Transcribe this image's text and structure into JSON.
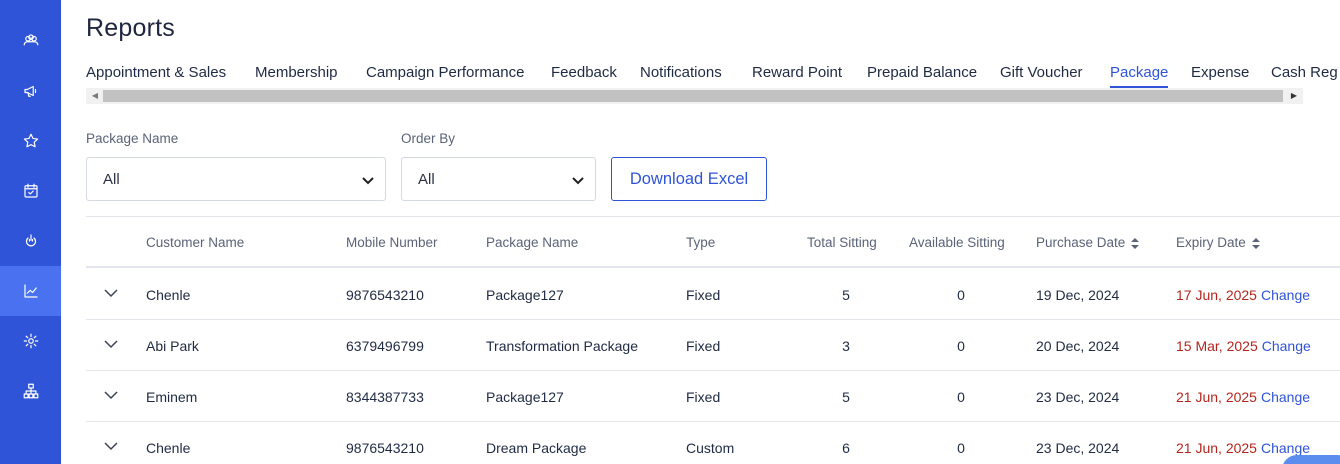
{
  "sidebar": {
    "items": [
      {
        "icon": "group-icon",
        "active": false
      },
      {
        "icon": "megaphone-icon",
        "active": false
      },
      {
        "icon": "star-icon",
        "active": false
      },
      {
        "icon": "calendar-icon",
        "active": false
      },
      {
        "icon": "touch-icon",
        "active": false
      },
      {
        "icon": "chart-icon",
        "active": true
      },
      {
        "icon": "gear-icon",
        "active": false
      },
      {
        "icon": "hierarchy-icon",
        "active": false
      }
    ]
  },
  "page": {
    "title": "Reports"
  },
  "tabs": [
    {
      "label": "Appointment & Sales",
      "active": false
    },
    {
      "label": "Membership",
      "active": false
    },
    {
      "label": "Campaign Performance",
      "active": false
    },
    {
      "label": "Feedback",
      "active": false
    },
    {
      "label": "Notifications",
      "active": false
    },
    {
      "label": "Reward Point",
      "active": false
    },
    {
      "label": "Prepaid Balance",
      "active": false
    },
    {
      "label": "Gift Voucher",
      "active": false
    },
    {
      "label": "Package",
      "active": true
    },
    {
      "label": "Expense",
      "active": false
    },
    {
      "label": "Cash Reg",
      "active": false
    }
  ],
  "filters": {
    "package_name": {
      "label": "Package Name",
      "value": "All"
    },
    "order_by": {
      "label": "Order By",
      "value": "All"
    },
    "download_label": "Download Excel"
  },
  "table": {
    "columns": [
      "Customer Name",
      "Mobile Number",
      "Package Name",
      "Type",
      "Total Sitting",
      "Available Sitting",
      "Purchase Date",
      "Expiry Date"
    ],
    "change_label": "Change",
    "rows": [
      {
        "customer": "Chenle",
        "mobile": "9876543210",
        "package": "Package127",
        "type": "Fixed",
        "total": "5",
        "available": "0",
        "purchase": "19 Dec, 2024",
        "expiry": "17 Jun, 2025"
      },
      {
        "customer": "Abi Park",
        "mobile": "6379496799",
        "package": "Transformation Package",
        "type": "Fixed",
        "total": "3",
        "available": "0",
        "purchase": "20 Dec, 2024",
        "expiry": "15 Mar, 2025"
      },
      {
        "customer": "Eminem",
        "mobile": "8344387733",
        "package": "Package127",
        "type": "Fixed",
        "total": "5",
        "available": "0",
        "purchase": "23 Dec, 2024",
        "expiry": "21 Jun, 2025"
      },
      {
        "customer": "Chenle",
        "mobile": "9876543210",
        "package": "Dream Package",
        "type": "Custom",
        "total": "6",
        "available": "0",
        "purchase": "23 Dec, 2024",
        "expiry": "21 Jun, 2025"
      }
    ]
  },
  "colors": {
    "sidebar_bg": "#2f54d8",
    "sidebar_active": "#4a72f0",
    "accent": "#2f54d8",
    "expiry": "#b3261e"
  }
}
